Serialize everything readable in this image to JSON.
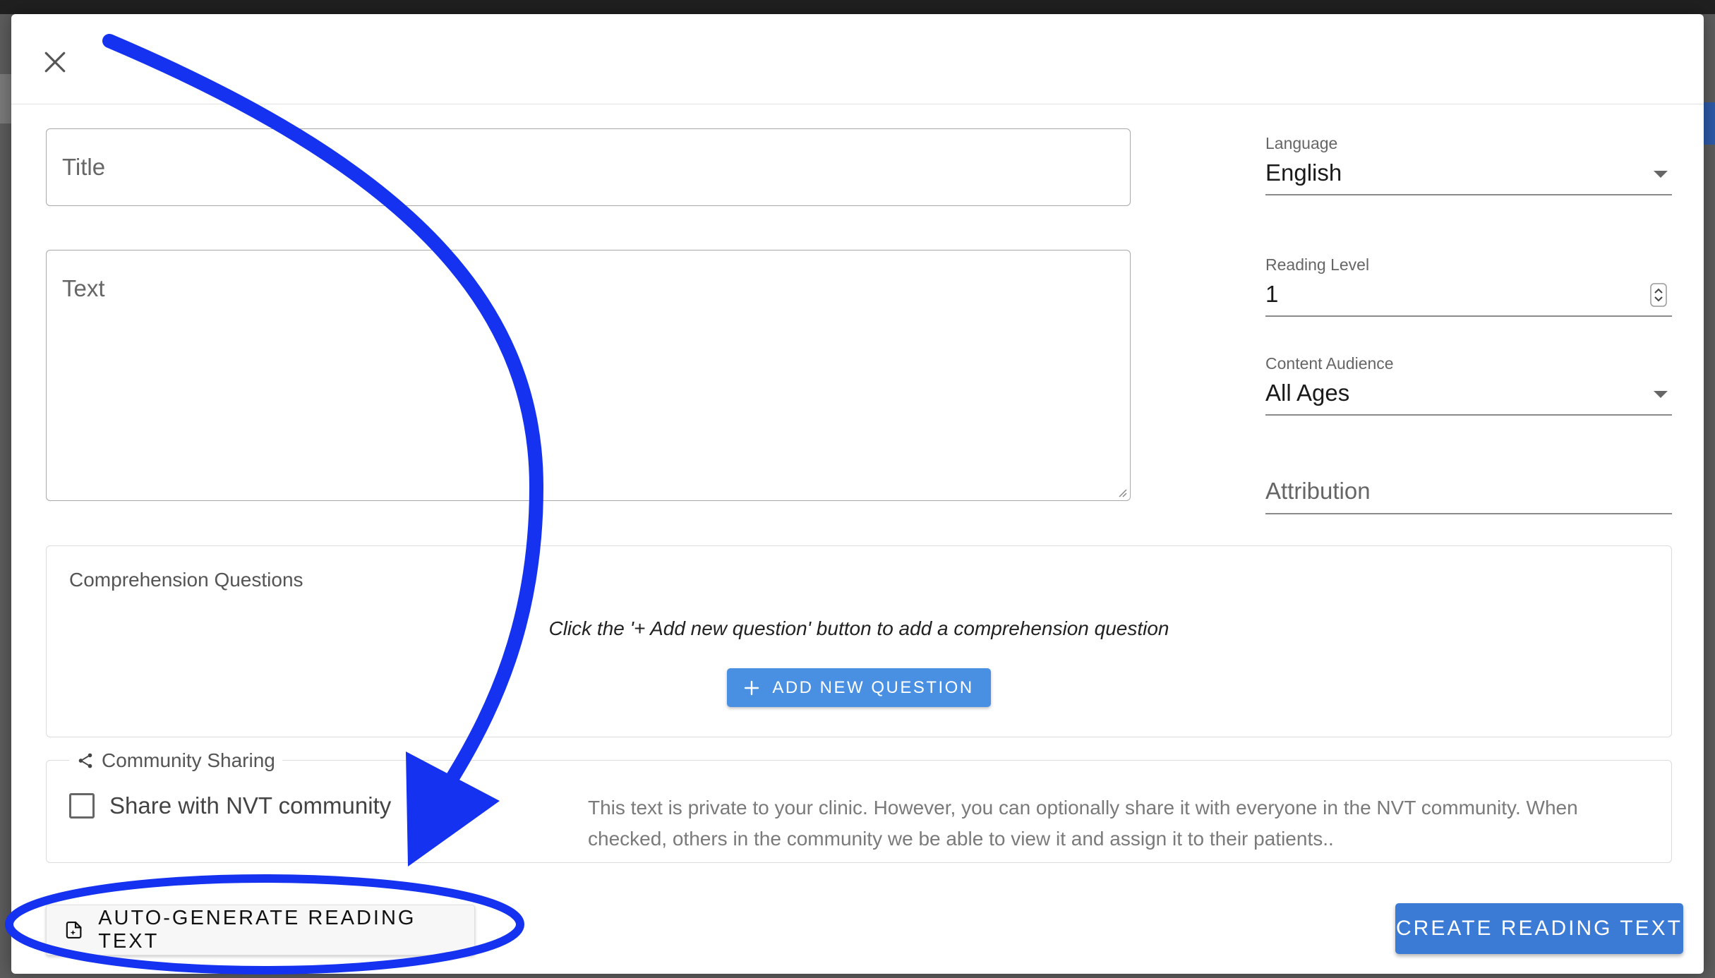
{
  "dialog": {
    "close_icon": "close-icon",
    "title_placeholder": "Title",
    "text_placeholder": "Text",
    "language": {
      "label": "Language",
      "value": "English"
    },
    "reading_level": {
      "label": "Reading Level",
      "value": "1"
    },
    "content_audience": {
      "label": "Content Audience",
      "value": "All Ages"
    },
    "attribution_placeholder": "Attribution",
    "comprehension": {
      "legend": "Comprehension Questions",
      "hint": "Click the '+ Add new question' button to add a comprehension question",
      "add_button": "ADD NEW QUESTION",
      "add_icon": "plus-icon"
    },
    "community": {
      "legend": "Community Sharing",
      "icon": "share-icon",
      "checkbox_label": "Share with NVT community",
      "checked": false,
      "description": "This text is private to your clinic. However, you can optionally share it with everyone in the NVT community. When checked, others in the community we be able to view it and assign it to their patients.."
    },
    "auto_generate_button": "AUTO-GENERATE READING TEXT",
    "auto_generate_icon": "auto-generate-icon",
    "create_button": "CREATE READING TEXT"
  },
  "colors": {
    "accent": "#3b7bd6",
    "add_button": "#4a90e2",
    "annotation": "#1432f0"
  },
  "annotation": {
    "shapes": [
      "curved-arrow",
      "ellipse-highlight"
    ]
  }
}
